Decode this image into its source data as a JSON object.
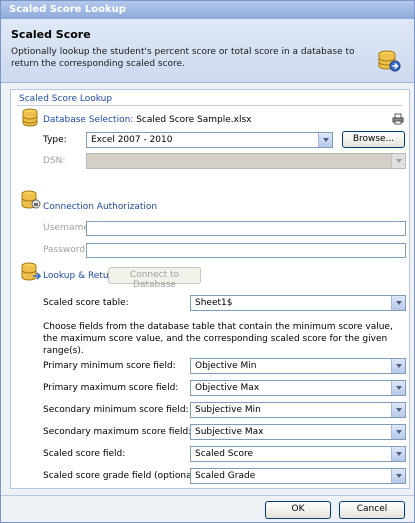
{
  "window": {
    "title": "Scaled Score Lookup"
  },
  "header": {
    "title": "Scaled Score",
    "description": "Optionally lookup the student's percent score or total score in a database to return the corresponding scaled score.",
    "icon": "database-icon"
  },
  "panel": {
    "title": "Scaled Score Lookup"
  },
  "database": {
    "label": "Database Selection:",
    "file": "Scaled Score Sample.xlsx",
    "type_label": "Type:",
    "type_value": "Excel 2007 - 2010",
    "browse_label": "Browse...",
    "dsn_label": "DSN:",
    "dsn_value": ""
  },
  "connection": {
    "label": "Connection Authorization",
    "username_label": "Username:",
    "password_label": "Password:",
    "username_value": "",
    "password_value": ""
  },
  "lookup": {
    "label": "Lookup & Return",
    "connect_label": "Connect to Database",
    "table_label": "Scaled score table:",
    "table_value": "Sheet1$",
    "description": "Choose fields from the database table that contain the minimum score value, the maximum score value, and the corresponding scaled score for the given range(s).",
    "fields": [
      {
        "label": "Primary minimum score field:",
        "value": "Objective Min"
      },
      {
        "label": "Primary maximum score field:",
        "value": "Objective Max"
      },
      {
        "label": "Secondary minimum score field:",
        "value": "Subjective Min"
      },
      {
        "label": "Secondary maximum score field:",
        "value": "Subjective Max"
      },
      {
        "label": "Scaled score field:",
        "value": "Scaled Score"
      },
      {
        "label": "Scaled score grade field (optional):",
        "value": "Scaled Grade"
      }
    ]
  },
  "footer": {
    "ok_label": "OK",
    "cancel_label": "Cancel"
  }
}
